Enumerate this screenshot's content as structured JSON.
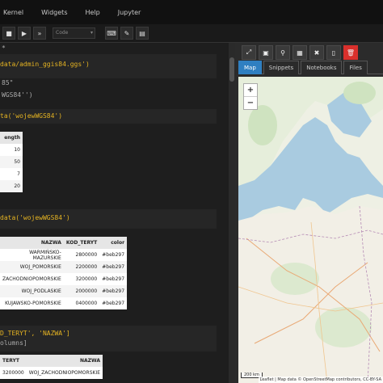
{
  "menu": [
    "Kernel",
    "Widgets",
    "Help",
    "Jupyter"
  ],
  "toolbar": {
    "cell_type": "Code"
  },
  "code": {
    "line1": "*",
    "line2": "data/admin_ggis84.ggs')",
    "line3": "85\"",
    "line4": "WGS84'')",
    "line5": "ta('wojewWGS84')",
    "line6": "data('wojewWGS84')",
    "line7": "D_TERYT', 'NAZWA']",
    "line8": "olumns]"
  },
  "small_table": {
    "header": "ength",
    "values": [
      "10",
      "50",
      "7",
      "20"
    ]
  },
  "main_table": {
    "columns": [
      "NAZWA",
      "KOD_TERYT",
      "color"
    ],
    "rows": [
      [
        "WARMIŃSKO-MAZURSKIE",
        "2800000",
        "#beb297"
      ],
      [
        "WOJ_POMORSKIE",
        "2200000",
        "#beb297"
      ],
      [
        "ZACHODNIOPOMORSKIE",
        "3200000",
        "#beb297"
      ],
      [
        "WOJ_PODLASKIE",
        "2000000",
        "#beb297"
      ],
      [
        "KUJAWSKO-POMORSKIE",
        "0400000",
        "#beb297"
      ]
    ]
  },
  "bottom_table": {
    "columns": [
      "TERYT",
      "NAZWA"
    ],
    "rows": [
      [
        "3200000",
        "WOJ_ZACHODNIOPOMORSKIE"
      ]
    ]
  },
  "panel": {
    "tabs": [
      "Map",
      "Snippets",
      "Notebooks",
      "Files"
    ],
    "attribution": "Leaflet | Map data © OpenStreetMap contributors, CC-BY-SA",
    "scale": "200 km"
  },
  "colors": {
    "accent": "#2f7fc1",
    "delete": "#d9302c",
    "code_string": "#e6b422"
  }
}
